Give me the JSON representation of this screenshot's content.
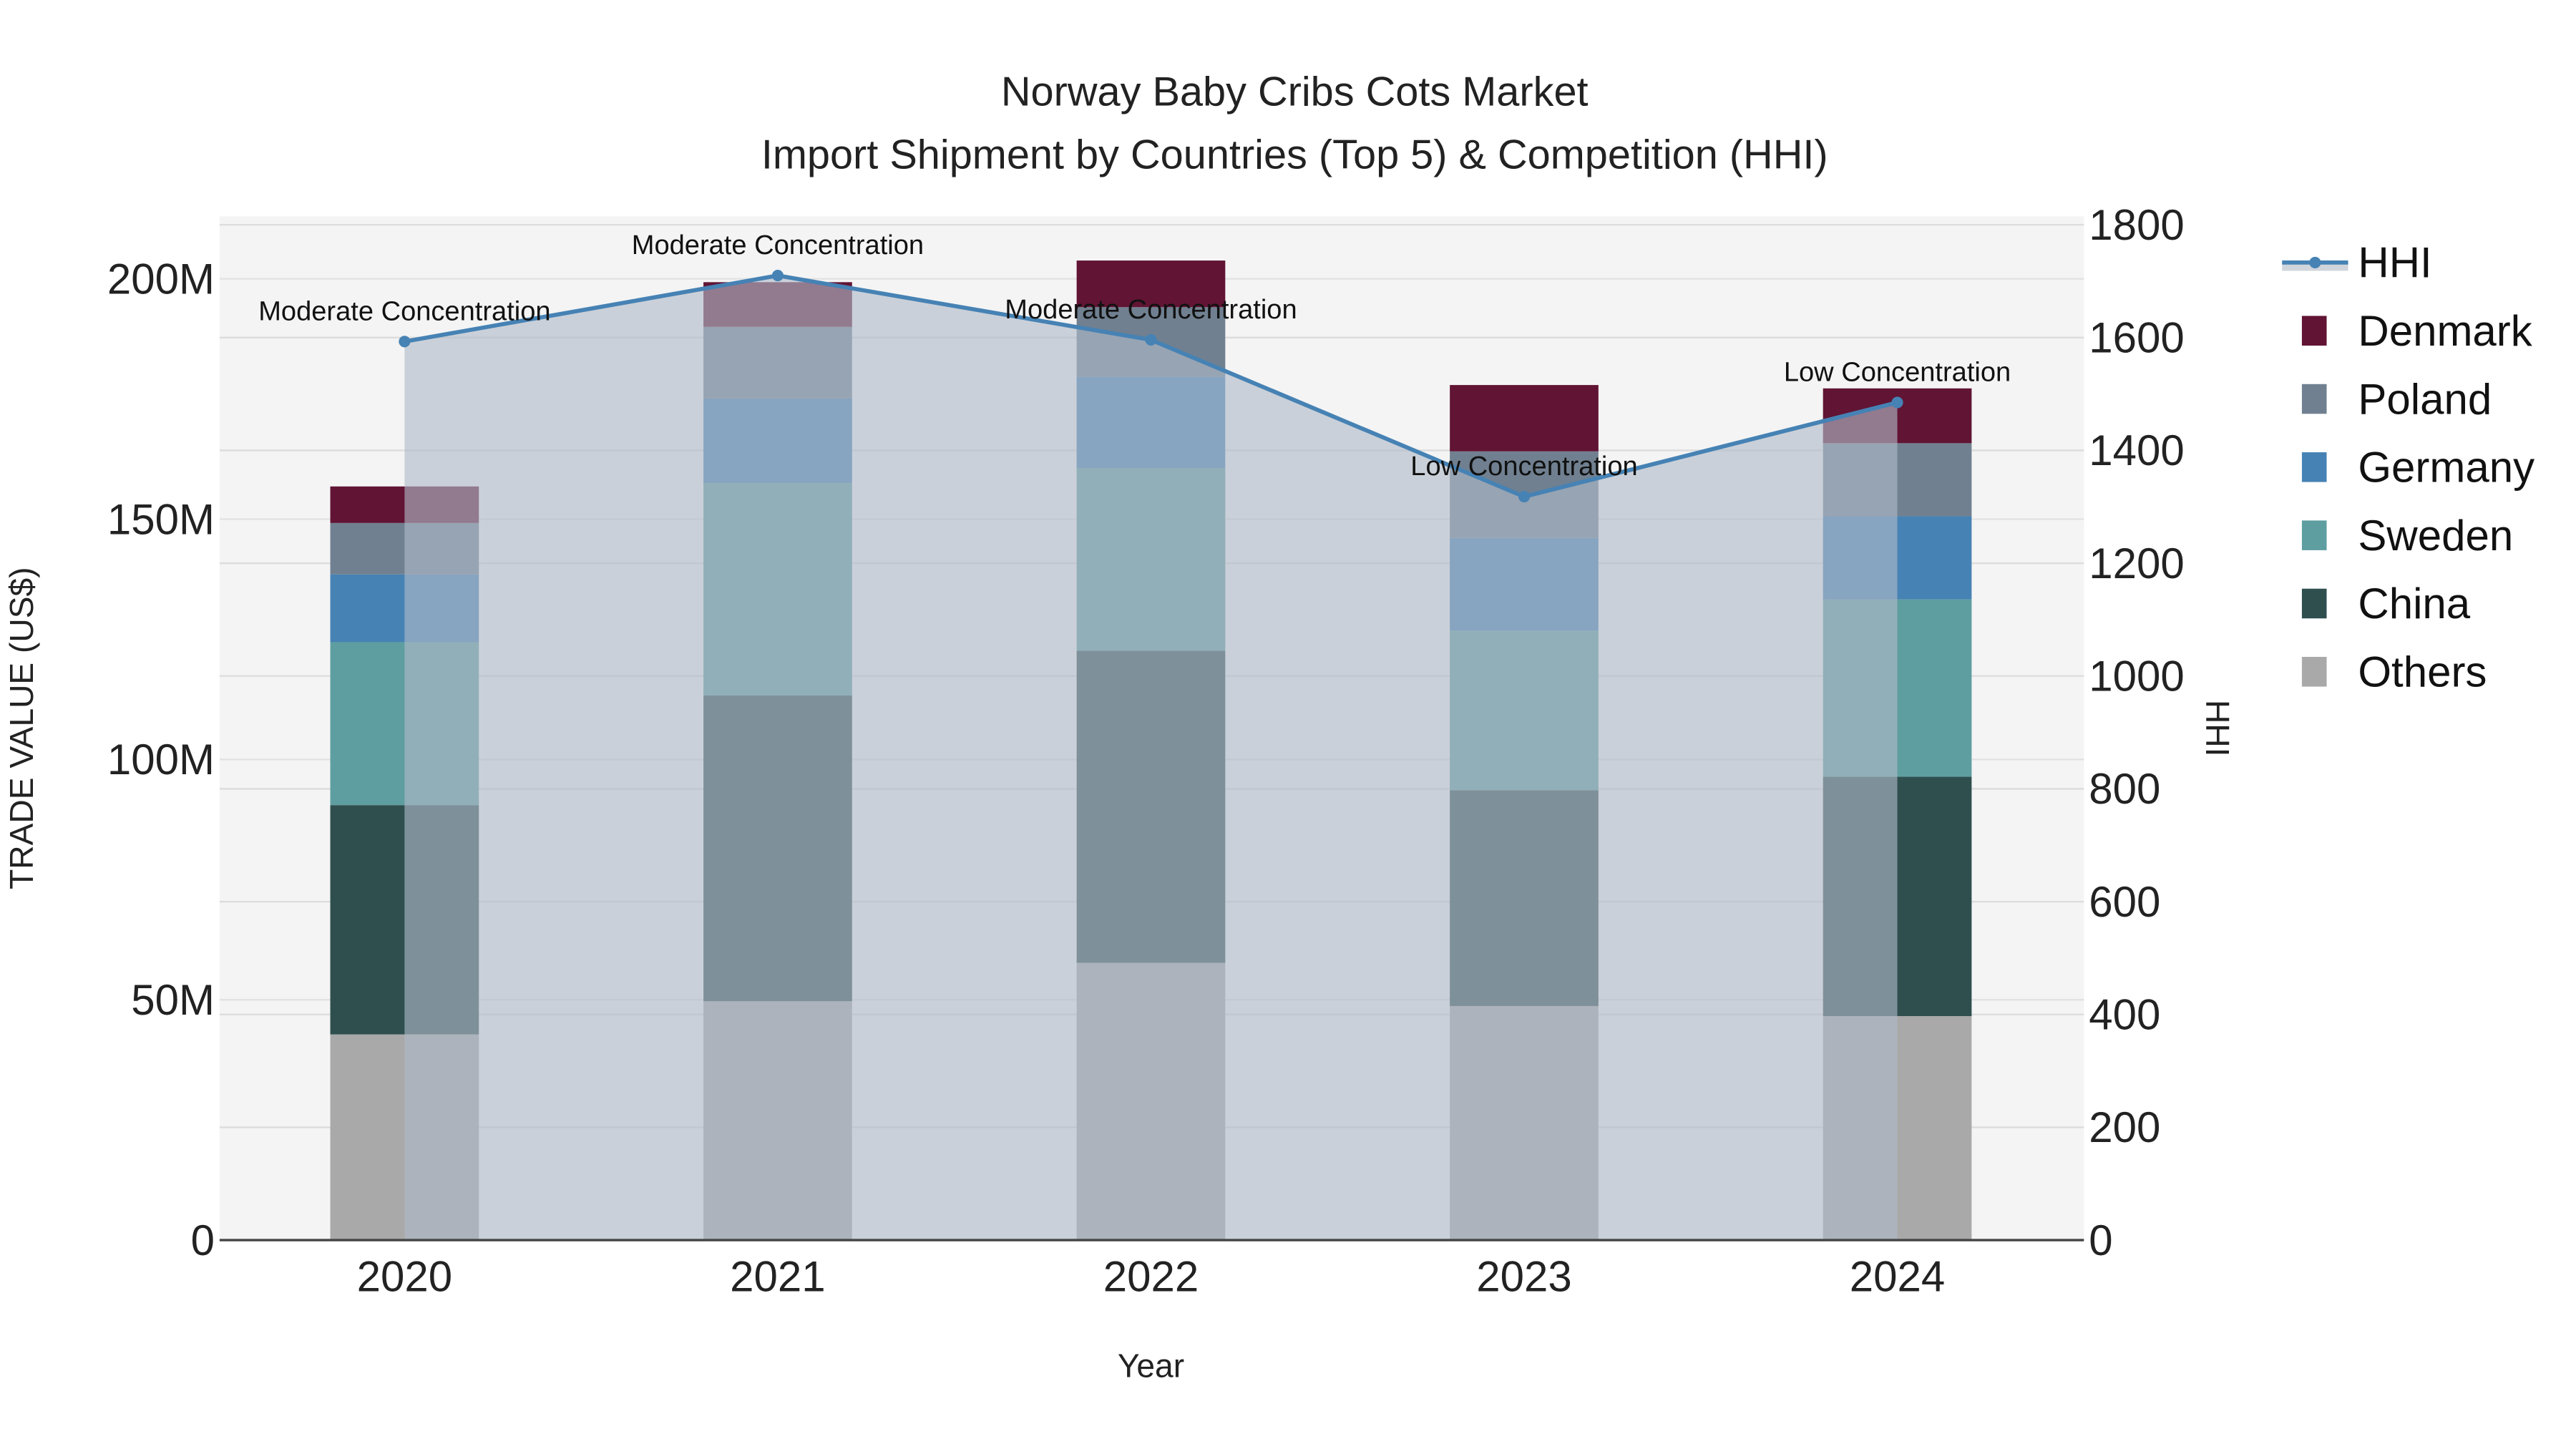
{
  "chart_data": {
    "type": "bar",
    "stacked": true,
    "title": "Norway Baby Cribs Cots Market",
    "subtitle": "Import Shipment by Countries (Top 5) & Competition (HHI)",
    "xlabel": "Year",
    "ylabel": "TRADE VALUE (US$)",
    "y2label": "HHI",
    "categories": [
      "2020",
      "2021",
      "2022",
      "2023",
      "2024"
    ],
    "ylim": [
      0,
      213000000
    ],
    "y_ticks": [
      0,
      50000000,
      100000000,
      150000000,
      200000000
    ],
    "y_tick_labels": [
      "0",
      "50M",
      "100M",
      "150M",
      "200M"
    ],
    "y2lim": [
      0,
      1815
    ],
    "y2_ticks": [
      0,
      200,
      400,
      600,
      800,
      1000,
      1200,
      1400,
      1600,
      1800
    ],
    "y2_tick_labels": [
      "0",
      "200",
      "400",
      "600",
      "800",
      "1000",
      "1200",
      "1400",
      "1600",
      "1800"
    ],
    "grid": true,
    "legend_position": "right",
    "series": [
      {
        "name": "Others",
        "color": "#a9a9a9",
        "values": [
          42800000,
          49700000,
          57700000,
          48700000,
          46600000
        ]
      },
      {
        "name": "China",
        "color": "#2f4f4f",
        "values": [
          47700000,
          63600000,
          64900000,
          44900000,
          49800000
        ]
      },
      {
        "name": "Sweden",
        "color": "#5f9ea0",
        "values": [
          33900000,
          44200000,
          38000000,
          33200000,
          36900000
        ]
      },
      {
        "name": "Germany",
        "color": "#4682b4",
        "values": [
          14100000,
          17600000,
          19000000,
          19300000,
          17300000
        ]
      },
      {
        "name": "Poland",
        "color": "#708090",
        "values": [
          10700000,
          14900000,
          14500000,
          18000000,
          15200000
        ]
      },
      {
        "name": "Denmark",
        "color": "#611434",
        "values": [
          7600000,
          9300000,
          9700000,
          13800000,
          11400000
        ]
      }
    ],
    "line_series": {
      "name": "HHI",
      "color": "#4682b4",
      "axis": "right",
      "values": [
        1593,
        1710,
        1596,
        1318,
        1485
      ],
      "annotations": [
        "Moderate Concentration",
        "Moderate Concentration",
        "Moderate Concentration",
        "Low Concentration",
        "Low Concentration"
      ]
    },
    "legend_order": [
      "HHI",
      "Denmark",
      "Poland",
      "Germany",
      "Sweden",
      "China",
      "Others"
    ]
  }
}
